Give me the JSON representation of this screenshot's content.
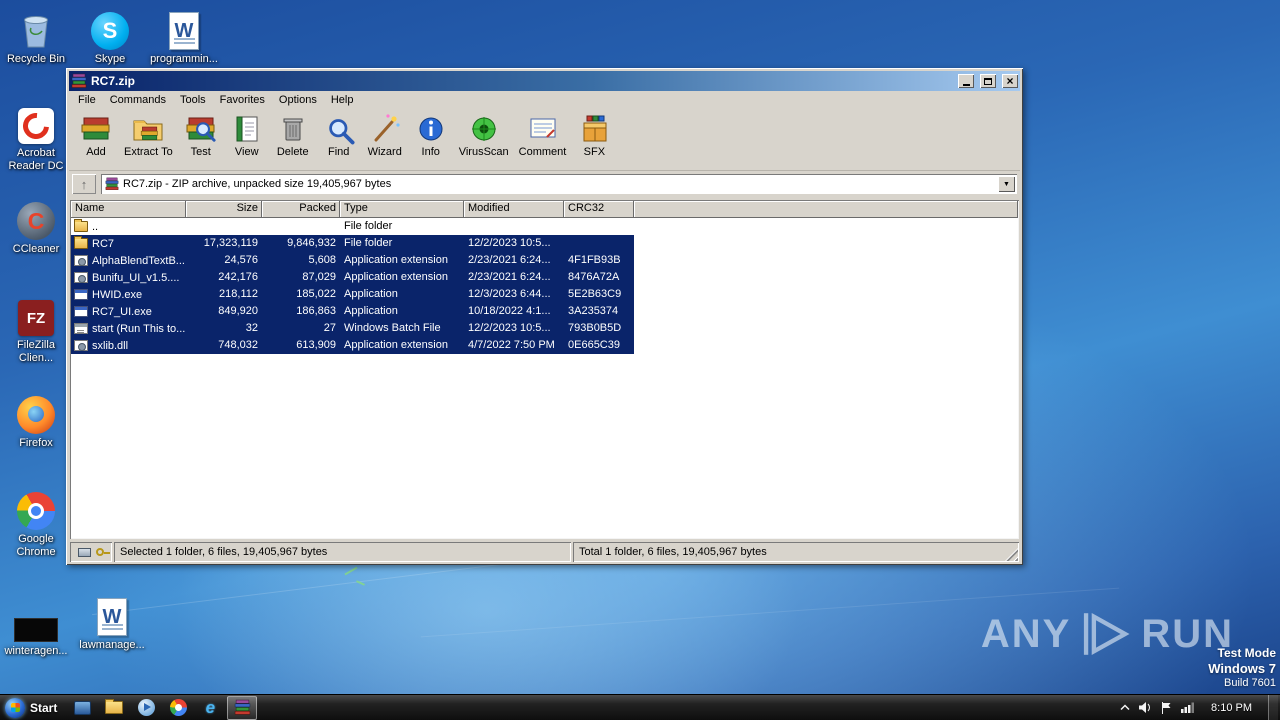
{
  "colors": {
    "selection": "#0a246a",
    "titlebar_gradient_start": "#0a246a",
    "titlebar_gradient_end": "#a6caf0",
    "taskbar": "#1a1a1a"
  },
  "desktop": {
    "icons": [
      {
        "label": "Recycle Bin",
        "icon": "recycle-bin"
      },
      {
        "label": "Skype",
        "icon": "skype"
      },
      {
        "label": "programmin...",
        "icon": "word-document"
      },
      {
        "label": "Acrobat Reader DC",
        "icon": "acrobat-reader"
      },
      {
        "label": "CCleaner",
        "icon": "ccleaner"
      },
      {
        "label": "FileZilla Clien...",
        "icon": "filezilla"
      },
      {
        "label": "Firefox",
        "icon": "firefox"
      },
      {
        "label": "Google Chrome",
        "icon": "chrome"
      },
      {
        "label": "winteragen...",
        "icon": "generic-black-app"
      },
      {
        "label": "lawmanage...",
        "icon": "word-document"
      }
    ],
    "watermark": {
      "brand_left": "ANY",
      "brand_right": "RUN",
      "mode": "Test Mode",
      "os": "Windows 7",
      "build": "Build 7601"
    }
  },
  "winrar": {
    "title": "RC7.zip",
    "menu": [
      "File",
      "Commands",
      "Tools",
      "Favorites",
      "Options",
      "Help"
    ],
    "toolbar": [
      {
        "label": "Add",
        "icon": "books"
      },
      {
        "label": "Extract To",
        "icon": "folder-books"
      },
      {
        "label": "Test",
        "icon": "books-magnifier"
      },
      {
        "label": "View",
        "icon": "open-book"
      },
      {
        "label": "Delete",
        "icon": "trash"
      },
      {
        "label": "Find",
        "icon": "magnifier"
      },
      {
        "label": "Wizard",
        "icon": "magic-wand"
      },
      {
        "label": "Info",
        "icon": "info-circle"
      },
      {
        "label": "VirusScan",
        "icon": "virus-scan"
      },
      {
        "label": "Comment",
        "icon": "comment-card"
      },
      {
        "label": "SFX",
        "icon": "sfx-box"
      }
    ],
    "address": "RC7.zip - ZIP archive, unpacked size 19,405,967 bytes",
    "columns": [
      "Name",
      "Size",
      "Packed",
      "Type",
      "Modified",
      "CRC32"
    ],
    "rows": [
      {
        "name": "..",
        "size": "",
        "packed": "",
        "type": "File folder",
        "modified": "",
        "crc": "",
        "icon": "up-folder",
        "selected": false
      },
      {
        "name": "RC7",
        "size": "17,323,119",
        "packed": "9,846,932",
        "type": "File folder",
        "modified": "12/2/2023 10:5...",
        "crc": "",
        "icon": "folder",
        "selected": true
      },
      {
        "name": "AlphaBlendTextB...",
        "size": "24,576",
        "packed": "5,608",
        "type": "Application extension",
        "modified": "2/23/2021 6:24...",
        "crc": "4F1FB93B",
        "icon": "dll",
        "selected": true
      },
      {
        "name": "Bunifu_UI_v1.5....",
        "size": "242,176",
        "packed": "87,029",
        "type": "Application extension",
        "modified": "2/23/2021 6:24...",
        "crc": "8476A72A",
        "icon": "dll",
        "selected": true
      },
      {
        "name": "HWID.exe",
        "size": "218,112",
        "packed": "185,022",
        "type": "Application",
        "modified": "12/3/2023 6:44...",
        "crc": "5E2B63C9",
        "icon": "exe",
        "selected": true
      },
      {
        "name": "RC7_UI.exe",
        "size": "849,920",
        "packed": "186,863",
        "type": "Application",
        "modified": "10/18/2022 4:1...",
        "crc": "3A235374",
        "icon": "exe",
        "selected": true
      },
      {
        "name": "start (Run This to...",
        "size": "32",
        "packed": "27",
        "type": "Windows Batch File",
        "modified": "12/2/2023 10:5...",
        "crc": "793B0B5D",
        "icon": "bat",
        "selected": true
      },
      {
        "name": "sxlib.dll",
        "size": "748,032",
        "packed": "613,909",
        "type": "Application extension",
        "modified": "4/7/2022 7:50 PM",
        "crc": "0E665C39",
        "icon": "dll",
        "selected": true
      }
    ],
    "status_left": "Selected 1 folder, 6 files, 19,405,967 bytes",
    "status_right": "Total 1 folder, 6 files, 19,405,967 bytes"
  },
  "taskbar": {
    "start_label": "Start",
    "time": "8:10 PM",
    "app_icons": [
      "app-window",
      "explorer",
      "media-player",
      "chrome",
      "internet-explorer",
      "winrar"
    ],
    "tray_icons": [
      "tray-expand",
      "volume",
      "action-center",
      "network"
    ]
  }
}
